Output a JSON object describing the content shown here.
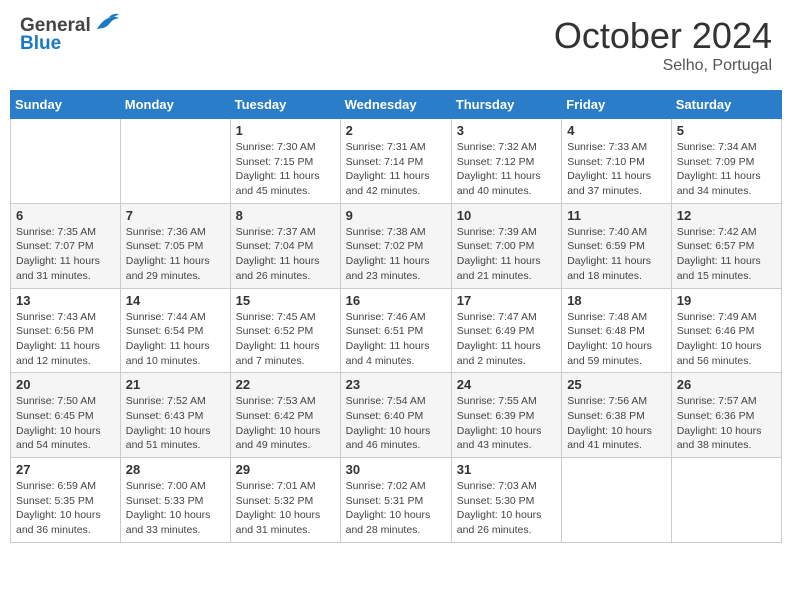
{
  "header": {
    "logo_general": "General",
    "logo_blue": "Blue",
    "month_title": "October 2024",
    "location": "Selho, Portugal"
  },
  "weekdays": [
    "Sunday",
    "Monday",
    "Tuesday",
    "Wednesday",
    "Thursday",
    "Friday",
    "Saturday"
  ],
  "weeks": [
    [
      {
        "day": "",
        "sunrise": "",
        "sunset": "",
        "daylight": ""
      },
      {
        "day": "",
        "sunrise": "",
        "sunset": "",
        "daylight": ""
      },
      {
        "day": "1",
        "sunrise": "Sunrise: 7:30 AM",
        "sunset": "Sunset: 7:15 PM",
        "daylight": "Daylight: 11 hours and 45 minutes."
      },
      {
        "day": "2",
        "sunrise": "Sunrise: 7:31 AM",
        "sunset": "Sunset: 7:14 PM",
        "daylight": "Daylight: 11 hours and 42 minutes."
      },
      {
        "day": "3",
        "sunrise": "Sunrise: 7:32 AM",
        "sunset": "Sunset: 7:12 PM",
        "daylight": "Daylight: 11 hours and 40 minutes."
      },
      {
        "day": "4",
        "sunrise": "Sunrise: 7:33 AM",
        "sunset": "Sunset: 7:10 PM",
        "daylight": "Daylight: 11 hours and 37 minutes."
      },
      {
        "day": "5",
        "sunrise": "Sunrise: 7:34 AM",
        "sunset": "Sunset: 7:09 PM",
        "daylight": "Daylight: 11 hours and 34 minutes."
      }
    ],
    [
      {
        "day": "6",
        "sunrise": "Sunrise: 7:35 AM",
        "sunset": "Sunset: 7:07 PM",
        "daylight": "Daylight: 11 hours and 31 minutes."
      },
      {
        "day": "7",
        "sunrise": "Sunrise: 7:36 AM",
        "sunset": "Sunset: 7:05 PM",
        "daylight": "Daylight: 11 hours and 29 minutes."
      },
      {
        "day": "8",
        "sunrise": "Sunrise: 7:37 AM",
        "sunset": "Sunset: 7:04 PM",
        "daylight": "Daylight: 11 hours and 26 minutes."
      },
      {
        "day": "9",
        "sunrise": "Sunrise: 7:38 AM",
        "sunset": "Sunset: 7:02 PM",
        "daylight": "Daylight: 11 hours and 23 minutes."
      },
      {
        "day": "10",
        "sunrise": "Sunrise: 7:39 AM",
        "sunset": "Sunset: 7:00 PM",
        "daylight": "Daylight: 11 hours and 21 minutes."
      },
      {
        "day": "11",
        "sunrise": "Sunrise: 7:40 AM",
        "sunset": "Sunset: 6:59 PM",
        "daylight": "Daylight: 11 hours and 18 minutes."
      },
      {
        "day": "12",
        "sunrise": "Sunrise: 7:42 AM",
        "sunset": "Sunset: 6:57 PM",
        "daylight": "Daylight: 11 hours and 15 minutes."
      }
    ],
    [
      {
        "day": "13",
        "sunrise": "Sunrise: 7:43 AM",
        "sunset": "Sunset: 6:56 PM",
        "daylight": "Daylight: 11 hours and 12 minutes."
      },
      {
        "day": "14",
        "sunrise": "Sunrise: 7:44 AM",
        "sunset": "Sunset: 6:54 PM",
        "daylight": "Daylight: 11 hours and 10 minutes."
      },
      {
        "day": "15",
        "sunrise": "Sunrise: 7:45 AM",
        "sunset": "Sunset: 6:52 PM",
        "daylight": "Daylight: 11 hours and 7 minutes."
      },
      {
        "day": "16",
        "sunrise": "Sunrise: 7:46 AM",
        "sunset": "Sunset: 6:51 PM",
        "daylight": "Daylight: 11 hours and 4 minutes."
      },
      {
        "day": "17",
        "sunrise": "Sunrise: 7:47 AM",
        "sunset": "Sunset: 6:49 PM",
        "daylight": "Daylight: 11 hours and 2 minutes."
      },
      {
        "day": "18",
        "sunrise": "Sunrise: 7:48 AM",
        "sunset": "Sunset: 6:48 PM",
        "daylight": "Daylight: 10 hours and 59 minutes."
      },
      {
        "day": "19",
        "sunrise": "Sunrise: 7:49 AM",
        "sunset": "Sunset: 6:46 PM",
        "daylight": "Daylight: 10 hours and 56 minutes."
      }
    ],
    [
      {
        "day": "20",
        "sunrise": "Sunrise: 7:50 AM",
        "sunset": "Sunset: 6:45 PM",
        "daylight": "Daylight: 10 hours and 54 minutes."
      },
      {
        "day": "21",
        "sunrise": "Sunrise: 7:52 AM",
        "sunset": "Sunset: 6:43 PM",
        "daylight": "Daylight: 10 hours and 51 minutes."
      },
      {
        "day": "22",
        "sunrise": "Sunrise: 7:53 AM",
        "sunset": "Sunset: 6:42 PM",
        "daylight": "Daylight: 10 hours and 49 minutes."
      },
      {
        "day": "23",
        "sunrise": "Sunrise: 7:54 AM",
        "sunset": "Sunset: 6:40 PM",
        "daylight": "Daylight: 10 hours and 46 minutes."
      },
      {
        "day": "24",
        "sunrise": "Sunrise: 7:55 AM",
        "sunset": "Sunset: 6:39 PM",
        "daylight": "Daylight: 10 hours and 43 minutes."
      },
      {
        "day": "25",
        "sunrise": "Sunrise: 7:56 AM",
        "sunset": "Sunset: 6:38 PM",
        "daylight": "Daylight: 10 hours and 41 minutes."
      },
      {
        "day": "26",
        "sunrise": "Sunrise: 7:57 AM",
        "sunset": "Sunset: 6:36 PM",
        "daylight": "Daylight: 10 hours and 38 minutes."
      }
    ],
    [
      {
        "day": "27",
        "sunrise": "Sunrise: 6:59 AM",
        "sunset": "Sunset: 5:35 PM",
        "daylight": "Daylight: 10 hours and 36 minutes."
      },
      {
        "day": "28",
        "sunrise": "Sunrise: 7:00 AM",
        "sunset": "Sunset: 5:33 PM",
        "daylight": "Daylight: 10 hours and 33 minutes."
      },
      {
        "day": "29",
        "sunrise": "Sunrise: 7:01 AM",
        "sunset": "Sunset: 5:32 PM",
        "daylight": "Daylight: 10 hours and 31 minutes."
      },
      {
        "day": "30",
        "sunrise": "Sunrise: 7:02 AM",
        "sunset": "Sunset: 5:31 PM",
        "daylight": "Daylight: 10 hours and 28 minutes."
      },
      {
        "day": "31",
        "sunrise": "Sunrise: 7:03 AM",
        "sunset": "Sunset: 5:30 PM",
        "daylight": "Daylight: 10 hours and 26 minutes."
      },
      {
        "day": "",
        "sunrise": "",
        "sunset": "",
        "daylight": ""
      },
      {
        "day": "",
        "sunrise": "",
        "sunset": "",
        "daylight": ""
      }
    ]
  ]
}
